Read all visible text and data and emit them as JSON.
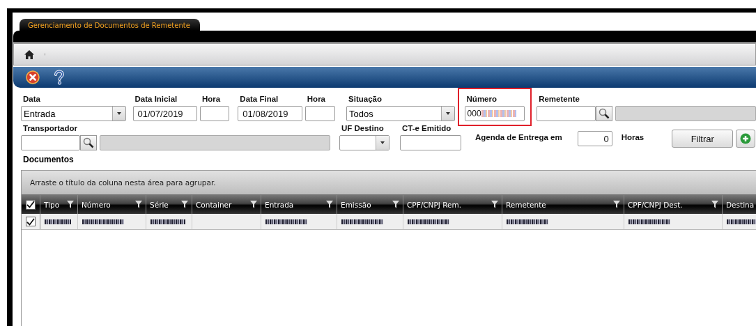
{
  "window": {
    "tab_title": "Gerenciamento de Documentos de Remetente"
  },
  "filters": {
    "data": {
      "label": "Data",
      "value": "Entrada"
    },
    "data_inicial": {
      "label": "Data Inicial",
      "value": "01/07/2019"
    },
    "hora_inicial": {
      "label": "Hora"
    },
    "data_final": {
      "label": "Data Final",
      "value": "01/08/2019"
    },
    "hora_final": {
      "label": "Hora"
    },
    "situacao": {
      "label": "Situação",
      "value": "Todos"
    },
    "numero": {
      "label": "Número",
      "value": "000",
      "value_blurred": true,
      "highlighted": true
    },
    "remetente": {
      "label": "Remetente"
    },
    "transportador": {
      "label": "Transportador"
    },
    "uf_destino": {
      "label": "UF Destino"
    },
    "cte_emitido": {
      "label": "CT-e Emitido"
    },
    "agenda": {
      "label": "Agenda de Entrega em",
      "value": "0",
      "unit": "Horas"
    },
    "filter_button": "Filtrar"
  },
  "documents": {
    "title": "Documentos",
    "group_hint": "Arraste o título da coluna nesta área para agrupar.",
    "all_checked": true,
    "columns": [
      {
        "label": "Tipo",
        "filter": true
      },
      {
        "label": "Número",
        "filter": true
      },
      {
        "label": "Série",
        "filter": true
      },
      {
        "label": "Container",
        "filter": true
      },
      {
        "label": "Entrada",
        "filter": true
      },
      {
        "label": "Emissão",
        "filter": true
      },
      {
        "label": "CPF/CNPJ Rem.",
        "filter": true
      },
      {
        "label": "Remetente",
        "filter": true
      },
      {
        "label": "CPF/CNPJ Dest.",
        "filter": true
      },
      {
        "label": "Destina"
      }
    ],
    "rows": [
      {
        "checked": true,
        "cells": [
          {
            "kind": "blurred"
          },
          {
            "kind": "blurred"
          },
          {
            "kind": "blurred"
          },
          {
            "kind": "empty"
          },
          {
            "kind": "blurred"
          },
          {
            "kind": "blurred"
          },
          {
            "kind": "blurred"
          },
          {
            "kind": "blurred"
          },
          {
            "kind": "blurred"
          },
          {
            "kind": "blurred"
          }
        ]
      }
    ]
  }
}
